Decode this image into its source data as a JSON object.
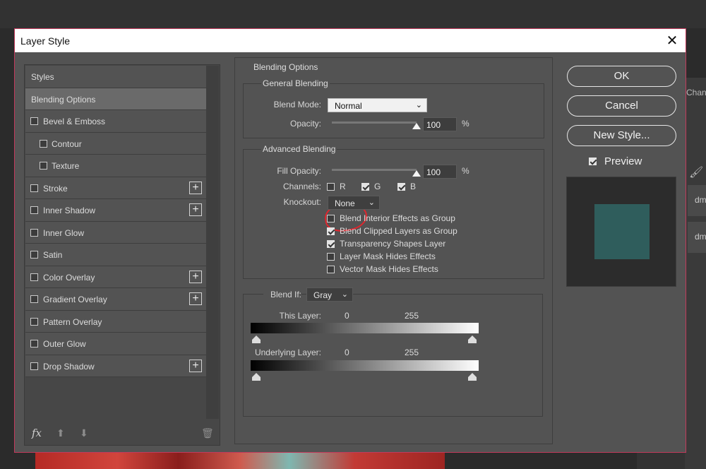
{
  "background": {
    "right_tab": "Chan",
    "layers": [
      "dm",
      "dm"
    ]
  },
  "dialog": {
    "title": "Layer Style",
    "close_glyph": "✕"
  },
  "styles_panel": {
    "items": [
      {
        "label": "Styles",
        "type": "head"
      },
      {
        "label": "Blending Options",
        "type": "active"
      },
      {
        "label": "Bevel & Emboss",
        "type": "check",
        "checked": false,
        "plus": false
      },
      {
        "label": "Contour",
        "type": "sub",
        "checked": false
      },
      {
        "label": "Texture",
        "type": "sub",
        "checked": false
      },
      {
        "label": "Stroke",
        "type": "check",
        "checked": false,
        "plus": true
      },
      {
        "label": "Inner Shadow",
        "type": "check",
        "checked": false,
        "plus": true
      },
      {
        "label": "Inner Glow",
        "type": "check",
        "checked": false,
        "plus": false
      },
      {
        "label": "Satin",
        "type": "check",
        "checked": false,
        "plus": false
      },
      {
        "label": "Color Overlay",
        "type": "check",
        "checked": false,
        "plus": true
      },
      {
        "label": "Gradient Overlay",
        "type": "check",
        "checked": false,
        "plus": true
      },
      {
        "label": "Pattern Overlay",
        "type": "check",
        "checked": false,
        "plus": false
      },
      {
        "label": "Outer Glow",
        "type": "check",
        "checked": false,
        "plus": false
      },
      {
        "label": "Drop Shadow",
        "type": "check",
        "checked": false,
        "plus": true
      }
    ],
    "footer": {
      "fx": "fx",
      "up_icon": "arrow-up-icon",
      "down_icon": "arrow-down-icon",
      "trash_icon": "trash-icon"
    }
  },
  "blending": {
    "section_title": "Blending Options",
    "general": {
      "title": "General Blending",
      "blend_mode_label": "Blend Mode:",
      "blend_mode_value": "Normal",
      "opacity_label": "Opacity:",
      "opacity_value": "100",
      "opacity_unit": "%",
      "opacity_level": 1.0
    },
    "advanced": {
      "title": "Advanced Blending",
      "fill_opacity_label": "Fill Opacity:",
      "fill_opacity_value": "100",
      "fill_opacity_unit": "%",
      "fill_opacity_level": 1.0,
      "channels_label": "Channels:",
      "channels": [
        {
          "label": "R",
          "checked": false
        },
        {
          "label": "G",
          "checked": true
        },
        {
          "label": "B",
          "checked": true
        }
      ],
      "knockout_label": "Knockout:",
      "knockout_value": "None",
      "options": [
        {
          "label": "Blend Interior Effects as Group",
          "checked": false
        },
        {
          "label": "Blend Clipped Layers as Group",
          "checked": true
        },
        {
          "label": "Transparency Shapes Layer",
          "checked": true
        },
        {
          "label": "Layer Mask Hides Effects",
          "checked": false
        },
        {
          "label": "Vector Mask Hides Effects",
          "checked": false
        }
      ]
    },
    "blend_if": {
      "label": "Blend If:",
      "value": "Gray",
      "this_layer_label": "This Layer:",
      "this_layer_min": "0",
      "this_layer_max": "255",
      "underlying_label": "Underlying Layer:",
      "underlying_min": "0",
      "underlying_max": "255"
    }
  },
  "buttons": {
    "ok": "OK",
    "cancel": "Cancel",
    "new_style": "New Style..."
  },
  "preview": {
    "label": "Preview",
    "checked": true,
    "swatch_color": "#2f5d5c"
  }
}
